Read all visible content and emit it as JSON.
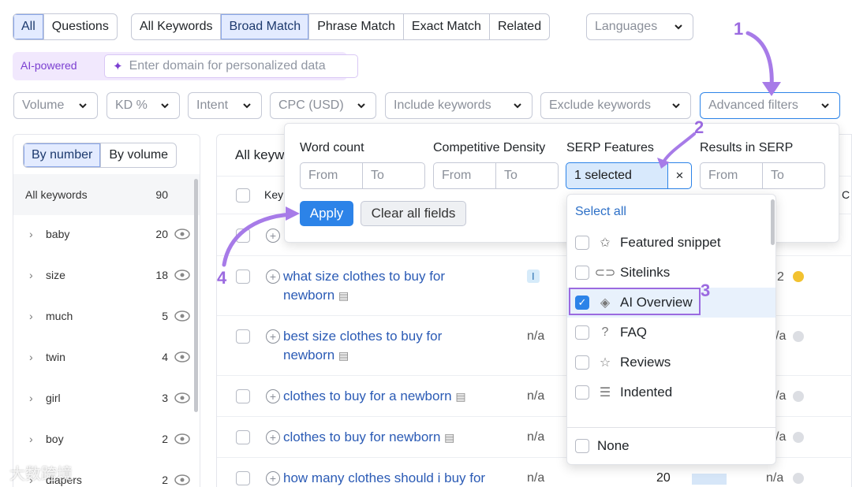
{
  "top_row": {
    "tabs_a": [
      "All",
      "Questions"
    ],
    "tabs_b": [
      "All Keywords",
      "Broad Match",
      "Phrase Match",
      "Exact Match",
      "Related"
    ],
    "languages_label": "Languages"
  },
  "ai": {
    "badge": "AI-powered",
    "placeholder": "Enter domain for personalized data"
  },
  "filters": [
    "Volume",
    "KD %",
    "Intent",
    "CPC (USD)",
    "Include keywords",
    "Exclude keywords",
    "Advanced filters"
  ],
  "sidebar": {
    "toggle": [
      "By number",
      "By volume"
    ],
    "header_label": "All keywords",
    "header_count": "90",
    "groups": [
      {
        "name": "baby",
        "count": "20"
      },
      {
        "name": "size",
        "count": "18"
      },
      {
        "name": "much",
        "count": "5"
      },
      {
        "name": "twin",
        "count": "4"
      },
      {
        "name": "girl",
        "count": "3"
      },
      {
        "name": "boy",
        "count": "2"
      },
      {
        "name": "diapers",
        "count": "2"
      }
    ]
  },
  "table": {
    "title_partial": "All keyw",
    "col_partial": "Key",
    "col_right_partial": "C",
    "rows": [
      {
        "keyword_line1": "what size clothes to buy for",
        "keyword_line2": "newborn",
        "intent": "I",
        "trailing": "2",
        "status_color": "#f2c230"
      },
      {
        "keyword_line1": "best size clothes to buy for",
        "keyword_line2": "newborn",
        "intent": "n/a",
        "trailing": "/a"
      },
      {
        "keyword_line1": "clothes to buy for a newborn",
        "intent": "n/a",
        "trailing": "/a"
      },
      {
        "keyword_line1": "clothes to buy for newborn",
        "intent": "n/a",
        "trailing": "/a"
      },
      {
        "keyword_line1": "how many clothes should i buy for",
        "intent": "n/a",
        "volume": "20",
        "trailing": "n/a"
      }
    ]
  },
  "advanced_panel": {
    "word_count": {
      "label": "Word count",
      "from": "From",
      "to": "To"
    },
    "competitive_density": {
      "label": "Competitive Density",
      "from": "From",
      "to": "To"
    },
    "serp_features": {
      "label": "SERP Features",
      "selected": "1 selected",
      "clear": "×"
    },
    "results_in_serp": {
      "label": "Results in SERP",
      "from": "From",
      "to": "To"
    },
    "apply": "Apply",
    "clear_all": "Clear all fields"
  },
  "serp_menu": {
    "select_all": "Select all",
    "items": [
      {
        "label": "Featured snippet",
        "icon": "featured-snippet-icon",
        "checked": false
      },
      {
        "label": "Sitelinks",
        "icon": "link-icon",
        "checked": false
      },
      {
        "label": "AI Overview",
        "icon": "ai-overview-icon",
        "checked": true
      },
      {
        "label": "FAQ",
        "icon": "question-icon",
        "checked": false
      },
      {
        "label": "Reviews",
        "icon": "star-icon",
        "checked": false
      },
      {
        "label": "Indented",
        "icon": "indented-icon",
        "checked": false
      }
    ],
    "none": "None"
  },
  "annotations": [
    "1",
    "2",
    "3",
    "4"
  ],
  "watermark": "大数跨境",
  "colors": {
    "accent": "#2c83e8",
    "annotation": "#9b6ae0",
    "link": "#2b5bb5",
    "ai_badge": "#7b3fd1"
  }
}
